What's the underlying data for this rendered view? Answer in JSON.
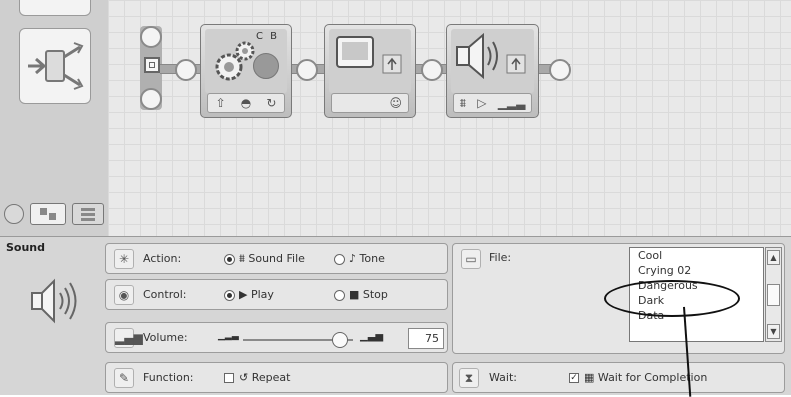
{
  "palette": {
    "tabs": [
      "common-palette",
      "complete-palette",
      "custom-palette"
    ]
  },
  "workspace": {
    "blocks": [
      {
        "name": "move-block",
        "ports_label": "C B"
      },
      {
        "name": "display-block"
      },
      {
        "name": "sound-block"
      }
    ]
  },
  "config": {
    "block_title": "Sound",
    "action": {
      "label": "Action:",
      "options": [
        "Sound File",
        "Tone"
      ],
      "selected": "Sound File"
    },
    "control": {
      "label": "Control:",
      "options": [
        "Play",
        "Stop"
      ],
      "selected": "Play"
    },
    "volume": {
      "label": "Volume:",
      "value": "75",
      "level_fraction": 0.75
    },
    "function": {
      "label": "Function:",
      "repeat_label": "Repeat",
      "repeat_checked": false
    },
    "file": {
      "label": "File:",
      "items": [
        "Cool",
        "Crying 02",
        "Dangerous",
        "Dark",
        "Data"
      ]
    },
    "wait": {
      "label": "Wait:",
      "option_label": "Wait for Completion",
      "checked": true
    }
  },
  "colors": {
    "panel_bg": "#d6d6d6",
    "row_bg": "#e6e6e6",
    "workspace_bg": "#e9e9e9",
    "annotation": "#111111"
  },
  "icons": [
    "switch-icon",
    "gear-icon",
    "display-icon",
    "speaker-icon",
    "wave-icon",
    "play-icon",
    "stop-icon",
    "volume-bars-icon",
    "wrench-icon",
    "folder-icon",
    "hourglass-icon",
    "eye-icon",
    "action-star-icon"
  ]
}
